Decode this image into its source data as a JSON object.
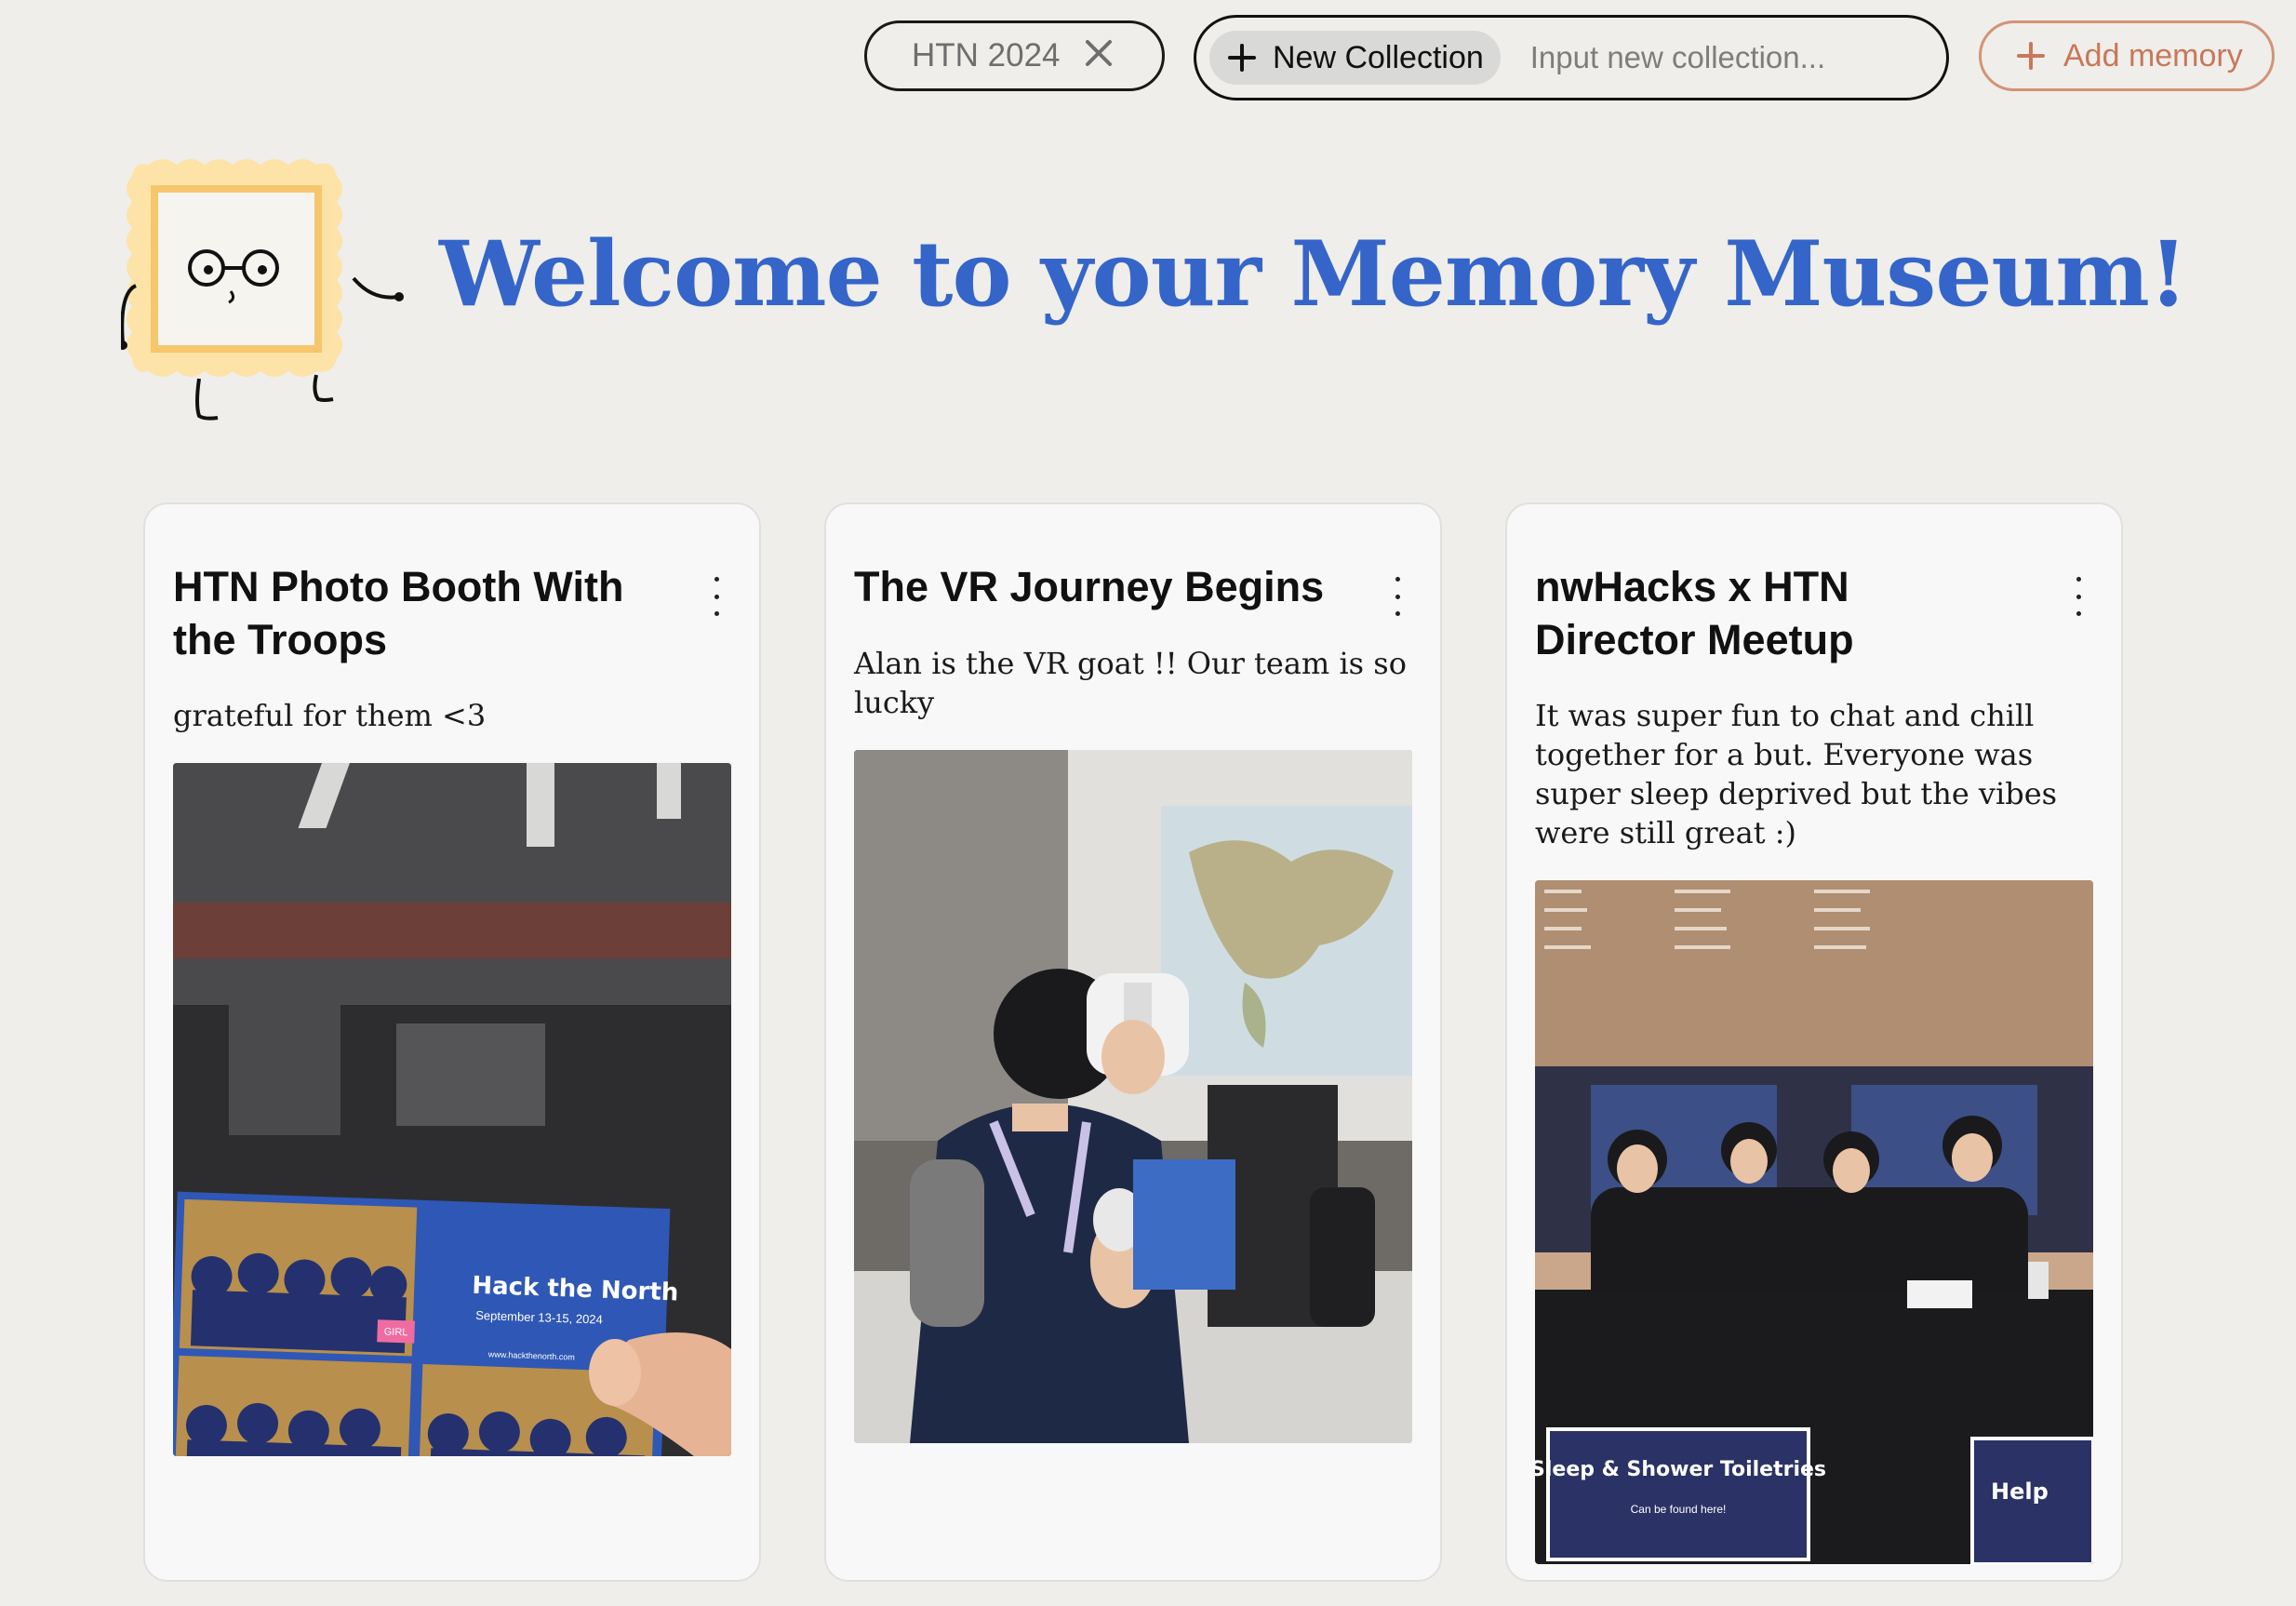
{
  "toolbar": {
    "active_collection": "HTN 2024",
    "new_collection_label": "New Collection",
    "new_collection_placeholder": "Input new collection...",
    "add_memory_label": "Add memory"
  },
  "header": {
    "title": "Welcome to your Memory Museum!"
  },
  "memories": [
    {
      "title": "HTN Photo Booth With the Troops",
      "description": "grateful for them <3",
      "photo": {
        "strip_title": "Hack the North",
        "strip_dates": "September 13-15, 2024",
        "strip_url": "www.hackthenorth.com",
        "badge": "GIRL"
      }
    },
    {
      "title": "The VR Journey Begins",
      "description": "Alan is the VR goat !! Our team is so lucky"
    },
    {
      "title": "nwHacks x HTN Director Meetup",
      "description": "It was super fun to chat and chill together for a but. Everyone was super sleep deprived but the vibes were still great :)",
      "photo": {
        "sign_title": "Sleep & Shower Toiletries",
        "sign_subtitle": "Can be found here!",
        "sign_2": "Help"
      }
    }
  ],
  "colors": {
    "background": "#efeeea",
    "title_blue": "#3565c9",
    "add_memory_accent": "#c7785a",
    "card_background": "#f8f8f8"
  }
}
